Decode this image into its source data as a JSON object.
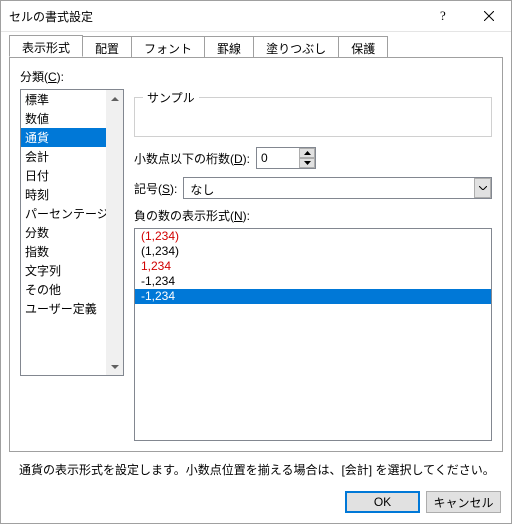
{
  "window": {
    "title": "セルの書式設定"
  },
  "tabs": [
    "表示形式",
    "配置",
    "フォント",
    "罫線",
    "塗りつぶし",
    "保護"
  ],
  "active_tab": 0,
  "category": {
    "label_pre": "分類(",
    "label_u": "C",
    "label_post": "):",
    "items": [
      "標準",
      "数値",
      "通貨",
      "会計",
      "日付",
      "時刻",
      "パーセンテージ",
      "分数",
      "指数",
      "文字列",
      "その他",
      "ユーザー定義"
    ],
    "selected": 2
  },
  "sample": {
    "legend": "サンプル"
  },
  "decimals": {
    "label_pre": "小数点以下の桁数(",
    "label_u": "D",
    "label_post": "):",
    "value": "0"
  },
  "symbol": {
    "label_pre": "記号(",
    "label_u": "S",
    "label_post": "):",
    "value": "なし"
  },
  "negative": {
    "label_pre": "負の数の表示形式(",
    "label_u": "N",
    "label_post": "):",
    "items": [
      {
        "text": "(1,234)",
        "cls": "red"
      },
      {
        "text": "(1,234)",
        "cls": ""
      },
      {
        "text": "1,234",
        "cls": "red"
      },
      {
        "text": "-1,234",
        "cls": ""
      },
      {
        "text": "-1,234",
        "cls": "red sel"
      }
    ]
  },
  "description": "通貨の表示形式を設定します。小数点位置を揃える場合は、[会計] を選択してください。",
  "buttons": {
    "ok": "OK",
    "cancel": "キャンセル"
  }
}
